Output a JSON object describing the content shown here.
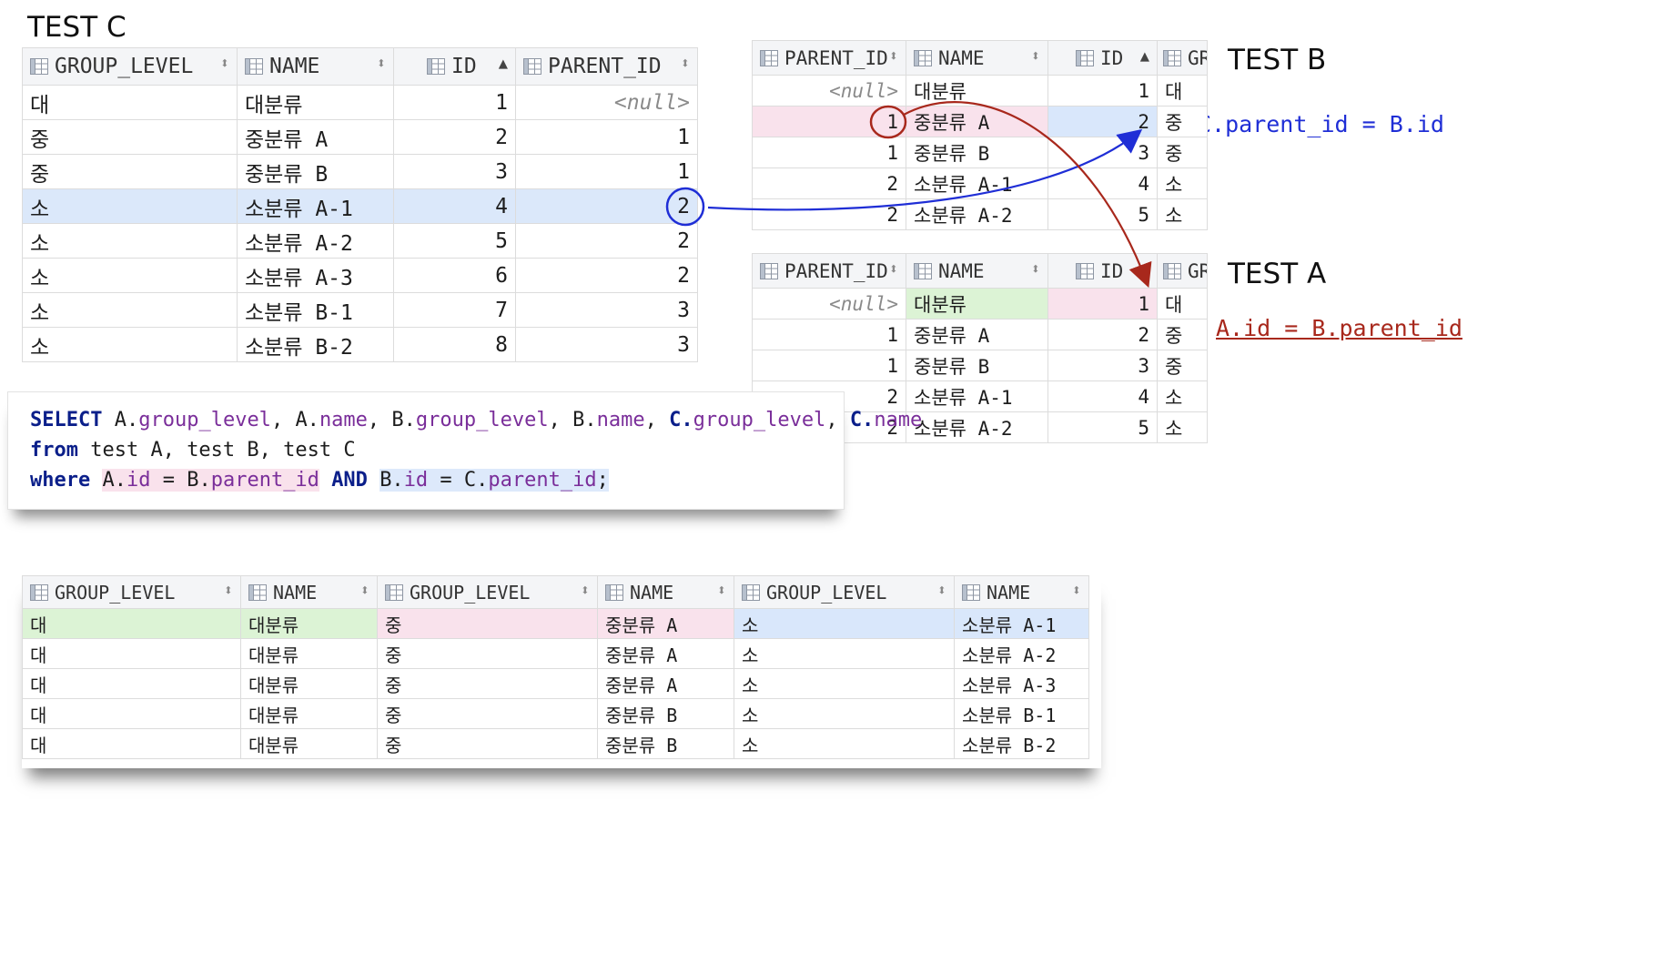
{
  "labels": {
    "test_c": "TEST C",
    "test_b": "TEST B",
    "test_a": "TEST A",
    "note_blue": "C.parent_id = B.id",
    "note_red": "A.id = B.parent_id"
  },
  "colors": {
    "blue_annotation": "#1f2ed6",
    "red_annotation": "#a8281c",
    "sql_keyword": "#0b1f8a",
    "sql_field": "#7a2e9a",
    "highlight_green": "#dcf3d5",
    "highlight_pink": "#f9e2ec",
    "highlight_blue": "#d9e7fb"
  },
  "test_c": {
    "headers": [
      "GROUP_LEVEL",
      "NAME",
      "ID",
      "PARENT_ID"
    ],
    "rows": [
      [
        "대",
        "대분류",
        "1",
        "<null>"
      ],
      [
        "중",
        "중분류 A",
        "2",
        "1"
      ],
      [
        "중",
        "중분류 B",
        "3",
        "1"
      ],
      [
        "소",
        "소분류 A-1",
        "4",
        "2"
      ],
      [
        "소",
        "소분류 A-2",
        "5",
        "2"
      ],
      [
        "소",
        "소분류 A-3",
        "6",
        "2"
      ],
      [
        "소",
        "소분류 B-1",
        "7",
        "3"
      ],
      [
        "소",
        "소분류 B-2",
        "8",
        "3"
      ]
    ]
  },
  "test_b": {
    "headers": [
      "PARENT_ID",
      "NAME",
      "ID",
      "GR"
    ],
    "rows": [
      [
        "<null>",
        "대분류",
        "1",
        "대"
      ],
      [
        "1",
        "중분류 A",
        "2",
        "중"
      ],
      [
        "1",
        "중분류 B",
        "3",
        "중"
      ],
      [
        "2",
        "소분류 A-1",
        "4",
        "소"
      ],
      [
        "2",
        "소분류 A-2",
        "5",
        "소"
      ]
    ]
  },
  "test_a": {
    "headers": [
      "PARENT_ID",
      "NAME",
      "ID",
      "GR"
    ],
    "rows": [
      [
        "<null>",
        "대분류",
        "1",
        "대"
      ],
      [
        "1",
        "중분류 A",
        "2",
        "중"
      ],
      [
        "1",
        "중분류 B",
        "3",
        "중"
      ],
      [
        "2",
        "소분류 A-1",
        "4",
        "소"
      ],
      [
        "2",
        "소분류 A-2",
        "5",
        "소"
      ]
    ]
  },
  "sql": {
    "l1_select": "SELECT",
    "l1_a": "A.",
    "l1_a_gl": "group_level",
    "l1_c1": ", ",
    "l1_a2": "A.",
    "l1_a_name": "name",
    "l1_c2": ", ",
    "l1_b": "B.",
    "l1_b_gl": "group_level",
    "l1_c3": ", ",
    "l1_b2": "B.",
    "l1_b_name": "name",
    "l1_c4": ", ",
    "l1_c": "C.",
    "l1_c_gl": "group_level",
    "l1_c5": ", ",
    "l1_c2a": "C.",
    "l1_c_name": "name",
    "l2_from": "from",
    "l2_rest": " test A, test B, test C",
    "l3_where": "where",
    "l3_cond1a": "A.",
    "l3_cond1b": "id",
    "l3_cond1c": " = B.",
    "l3_cond1d": "parent_id",
    "l3_and": "AND",
    "l3_cond2a": "B.",
    "l3_cond2b": "id",
    "l3_cond2c": " = C.",
    "l3_cond2d": "parent_id",
    "l3_semi": ";"
  },
  "result": {
    "headers": [
      "GROUP_LEVEL",
      "NAME",
      "GROUP_LEVEL",
      "NAME",
      "GROUP_LEVEL",
      "NAME"
    ],
    "rows": [
      [
        "대",
        "대분류",
        "중",
        "중분류 A",
        "소",
        "소분류 A-1"
      ],
      [
        "대",
        "대분류",
        "중",
        "중분류 A",
        "소",
        "소분류 A-2"
      ],
      [
        "대",
        "대분류",
        "중",
        "중분류 A",
        "소",
        "소분류 A-3"
      ],
      [
        "대",
        "대분류",
        "중",
        "중분류 B",
        "소",
        "소분류 B-1"
      ],
      [
        "대",
        "대분류",
        "중",
        "중분류 B",
        "소",
        "소분류 B-2"
      ]
    ]
  }
}
